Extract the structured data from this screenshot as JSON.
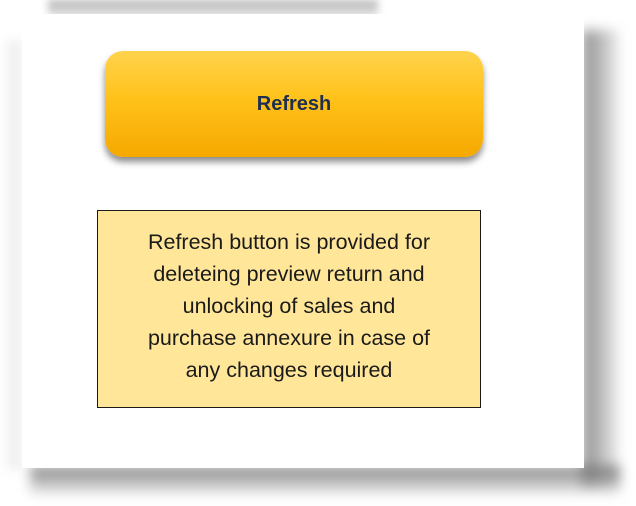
{
  "refresh_button": {
    "label": "Refresh"
  },
  "note": {
    "text": "Refresh button is provided for\ndeleteing  preview return and\nunlocking of sales and\npurchase annexure in case of\nany changes required"
  },
  "colors": {
    "button_gradient_top": "#ffd34d",
    "button_gradient_bottom": "#f5a800",
    "button_text": "#1e2f50",
    "note_background": "#ffe699",
    "note_border": "#1a1a1a"
  }
}
